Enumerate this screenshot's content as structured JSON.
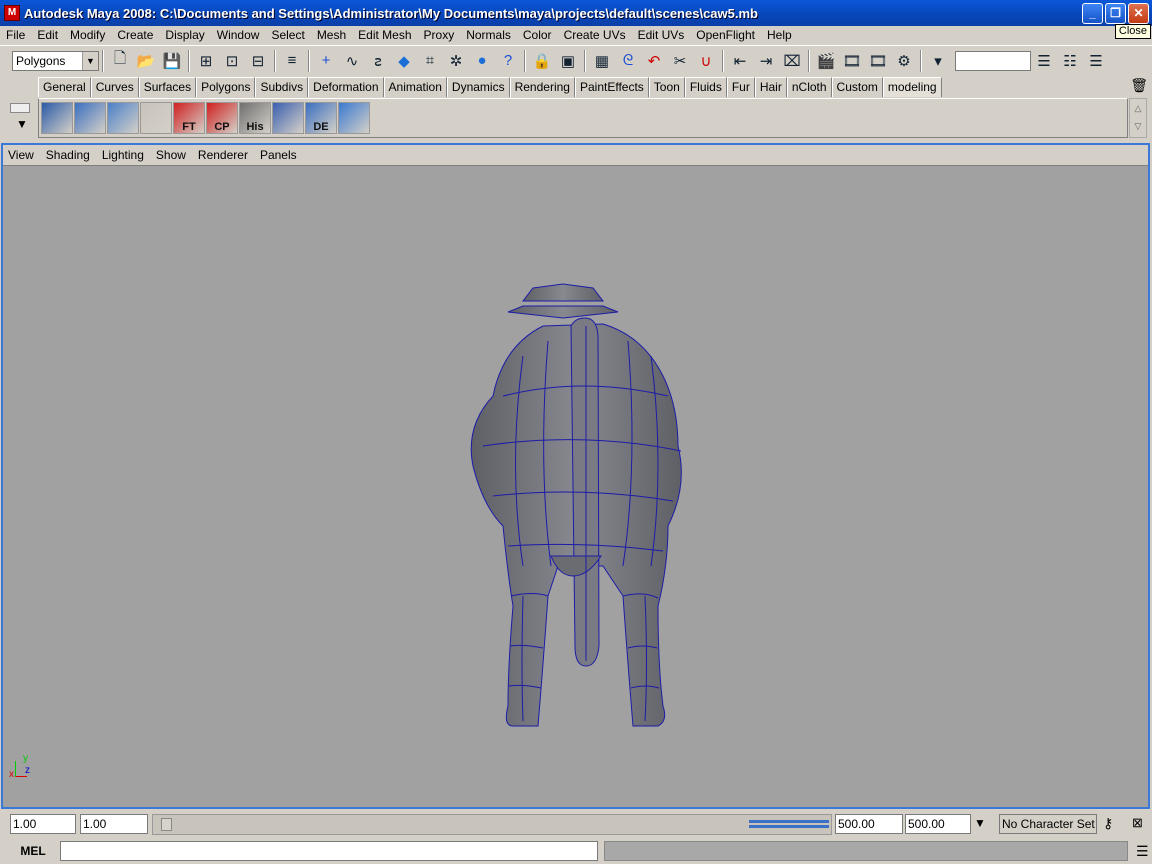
{
  "window": {
    "title": "Autodesk Maya 2008: C:\\Documents and Settings\\Administrator\\My Documents\\maya\\projects\\default\\scenes\\caw5.mb",
    "close_tooltip": "Close"
  },
  "menubar": [
    "File",
    "Edit",
    "Modify",
    "Create",
    "Display",
    "Window",
    "Select",
    "Mesh",
    "Edit Mesh",
    "Proxy",
    "Normals",
    "Color",
    "Create UVs",
    "Edit UVs",
    "OpenFlight",
    "Help"
  ],
  "status_line": {
    "menu_set": "Polygons"
  },
  "shelf": {
    "tabs": [
      "General",
      "Curves",
      "Surfaces",
      "Polygons",
      "Subdivs",
      "Deformation",
      "Animation",
      "Dynamics",
      "Rendering",
      "PaintEffects",
      "Toon",
      "Fluids",
      "Fur",
      "Hair",
      "nCloth",
      "Custom",
      "modeling"
    ],
    "active_tab": "modeling",
    "buttons": [
      "",
      "",
      "",
      "",
      "FT",
      "CP",
      "His",
      "",
      "DE",
      ""
    ]
  },
  "panel": {
    "menu": [
      "View",
      "Shading",
      "Lighting",
      "Show",
      "Renderer",
      "Panels"
    ]
  },
  "range": {
    "start_time": "1.00",
    "playback_start": "1.00",
    "playback_end": "500.00",
    "end_time": "500.00",
    "character_set": "No Character Set"
  },
  "command_line": {
    "label": "MEL"
  },
  "axis": {
    "x": "x",
    "y": "y",
    "z": "z"
  }
}
